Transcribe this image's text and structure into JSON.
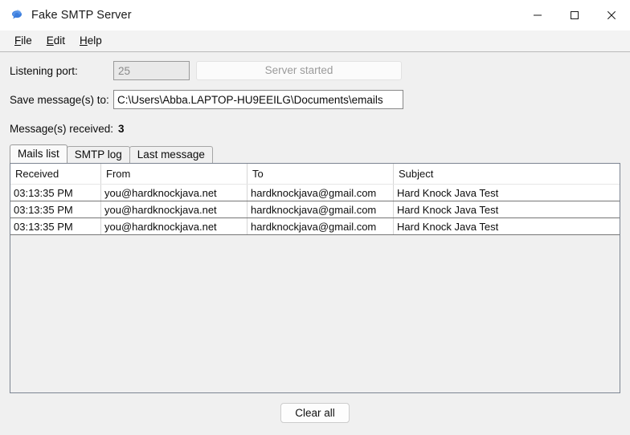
{
  "window": {
    "title": "Fake SMTP Server",
    "icon": "chat-bubble-icon",
    "controls": {
      "minimize": "minimize-icon",
      "maximize": "maximize-icon",
      "close": "close-icon"
    }
  },
  "menubar": {
    "items": [
      {
        "mnemonic": "F",
        "rest": "ile"
      },
      {
        "mnemonic": "E",
        "rest": "dit"
      },
      {
        "mnemonic": "H",
        "rest": "elp"
      }
    ]
  },
  "form": {
    "port_label": "Listening port:",
    "port_value": "25",
    "server_button": "Server started",
    "save_label": "Save message(s) to:",
    "save_path": "C:\\Users\\Abba.LAPTOP-HU9EEILG\\Documents\\emails",
    "received_label": "Message(s) received:",
    "received_count": "3"
  },
  "tabs": [
    {
      "label": "Mails list",
      "active": true
    },
    {
      "label": "SMTP log",
      "active": false
    },
    {
      "label": "Last message",
      "active": false
    }
  ],
  "table": {
    "columns": [
      "Received",
      "From",
      "To",
      "Subject"
    ],
    "rows": [
      {
        "received": "03:13:35 PM",
        "from": "you@hardknockjava.net",
        "to": "hardknockjava@gmail.com",
        "subject": "Hard Knock Java Test"
      },
      {
        "received": "03:13:35 PM",
        "from": "you@hardknockjava.net",
        "to": "hardknockjava@gmail.com",
        "subject": "Hard Knock Java Test"
      },
      {
        "received": "03:13:35 PM",
        "from": "you@hardknockjava.net",
        "to": "hardknockjava@gmail.com",
        "subject": "Hard Knock Java Test"
      }
    ]
  },
  "footer": {
    "clear_button": "Clear all"
  },
  "colors": {
    "window_background": "#f0f0f0",
    "titlebar_background": "#ffffff",
    "accent_icon": "#3b7ddd",
    "table_border": "#7d8592",
    "disabled_text": "#9b9b9b"
  }
}
